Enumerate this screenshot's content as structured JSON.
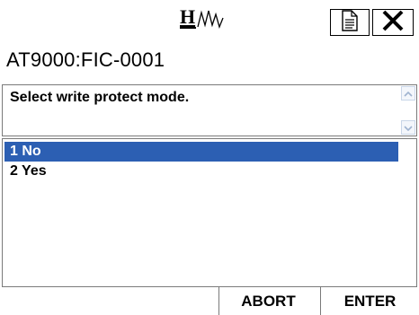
{
  "header": {
    "logo_icon": "hart-logo-icon",
    "doc_icon": "document-icon",
    "close_icon": "close-icon",
    "tag": "AT9000:FIC-0001"
  },
  "prompt": {
    "text": "Select write protect mode."
  },
  "options": [
    {
      "label": "1 No",
      "selected": true
    },
    {
      "label": "2 Yes",
      "selected": false
    }
  ],
  "actions": {
    "abort_label": "ABORT",
    "enter_label": "ENTER"
  },
  "colors": {
    "selection": "#2c5fb3"
  }
}
